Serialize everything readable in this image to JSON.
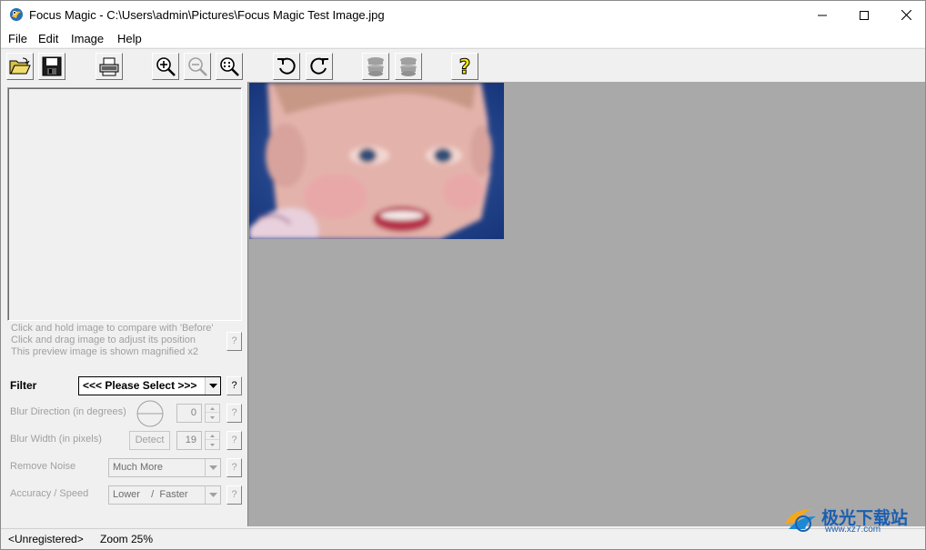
{
  "window": {
    "title": "Focus Magic - C:\\Users\\admin\\Pictures\\Focus Magic Test Image.jpg"
  },
  "menu": {
    "file": "File",
    "edit": "Edit",
    "image": "Image",
    "help": "Help"
  },
  "toolbar": {
    "buttons": [
      {
        "name": "open-folder-icon",
        "enabled": true
      },
      {
        "name": "save-disk-icon",
        "enabled": true
      },
      {
        "name": "print-icon",
        "enabled": true
      },
      {
        "name": "zoom-in-icon",
        "enabled": true
      },
      {
        "name": "zoom-out-icon",
        "enabled": false
      },
      {
        "name": "zoom-fit-icon",
        "enabled": true
      },
      {
        "name": "rotate-left-icon",
        "enabled": true
      },
      {
        "name": "rotate-right-icon",
        "enabled": true
      },
      {
        "name": "filter-stack-icon",
        "enabled": false
      },
      {
        "name": "filter-stack-all-icon",
        "enabled": false
      },
      {
        "name": "help-icon",
        "enabled": true
      }
    ]
  },
  "preview": {
    "hint1": "Click and hold image to compare with 'Before'",
    "hint2": "Click and drag image to adjust its position",
    "hint3": "This preview image is shown magnified x2"
  },
  "controls": {
    "filter_label": "Filter",
    "filter_value": "<<< Please Select >>>",
    "blur_direction_label": "Blur Direction (in degrees)",
    "blur_direction_value": "0",
    "blur_width_label": "Blur Width (in pixels)",
    "detect_label": "Detect",
    "blur_width_value": "19",
    "remove_noise_label": "Remove Noise",
    "remove_noise_value": "Much More",
    "accuracy_label": "Accuracy / Speed",
    "accuracy_value": "Lower    /  Faster",
    "help_glyph": "?"
  },
  "status": {
    "registration": "<Unregistered>",
    "zoom": "Zoom 25%"
  },
  "watermark": {
    "text": "极光下载站",
    "url": "www.xz7.com"
  },
  "colors": {
    "canvas": "#a9a9a9",
    "panel": "#f0f0f0",
    "watermark": "#1b5fb0"
  }
}
